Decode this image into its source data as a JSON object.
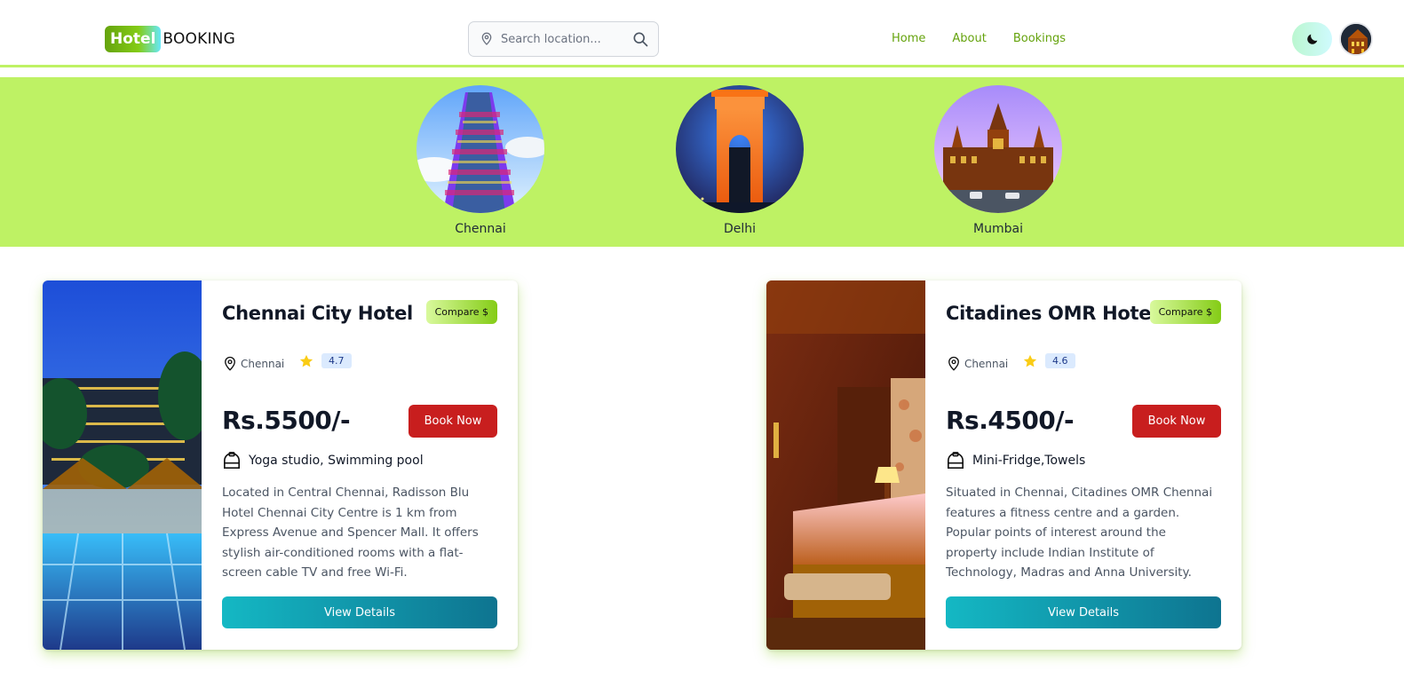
{
  "header": {
    "logo_badge": "Hotel",
    "logo_text": "BOOKING",
    "search_placeholder": "Search location...",
    "nav": [
      "Home",
      "About",
      "Bookings"
    ],
    "theme_icon": "moon-icon",
    "avatar_icon": "user-avatar"
  },
  "cities": [
    {
      "name": "Chennai",
      "image": "temple-gopuram"
    },
    {
      "name": "Delhi",
      "image": "india-gate"
    },
    {
      "name": "Mumbai",
      "image": "cst-station"
    }
  ],
  "hotels": [
    {
      "title": "Chennai City Hotel",
      "compare": "Compare $",
      "location": "Chennai",
      "rating": "4.7",
      "price": "Rs.5500/-",
      "book": "Book Now",
      "amenities": "Yoga studio, Swimming pool",
      "description": "Located in Central Chennai, Radisson Blu Hotel Chennai City Centre is 1 km from Express Avenue and Spencer Mall. It offers stylish air-conditioned rooms with a flat-screen cable TV and free Wi-Fi.",
      "details": "View Details"
    },
    {
      "title": "Citadines OMR Hotel",
      "compare": "Compare $",
      "location": "Chennai",
      "rating": "4.6",
      "price": "Rs.4500/-",
      "book": "Book Now",
      "amenities": "Mini-Fridge,Towels",
      "description": "Situated in Chennai, Citadines OMR Chennai features a fitness centre and a garden. Popular points of interest around the property include Indian Institute of Technology, Madras and Anna University.",
      "details": "View Details"
    }
  ],
  "colors": {
    "accent": "#bef264",
    "nav_link": "#65a30d",
    "book_button": "#c81e1e",
    "details_gradient_start": "#14b8c4",
    "details_gradient_end": "#0e7490"
  }
}
